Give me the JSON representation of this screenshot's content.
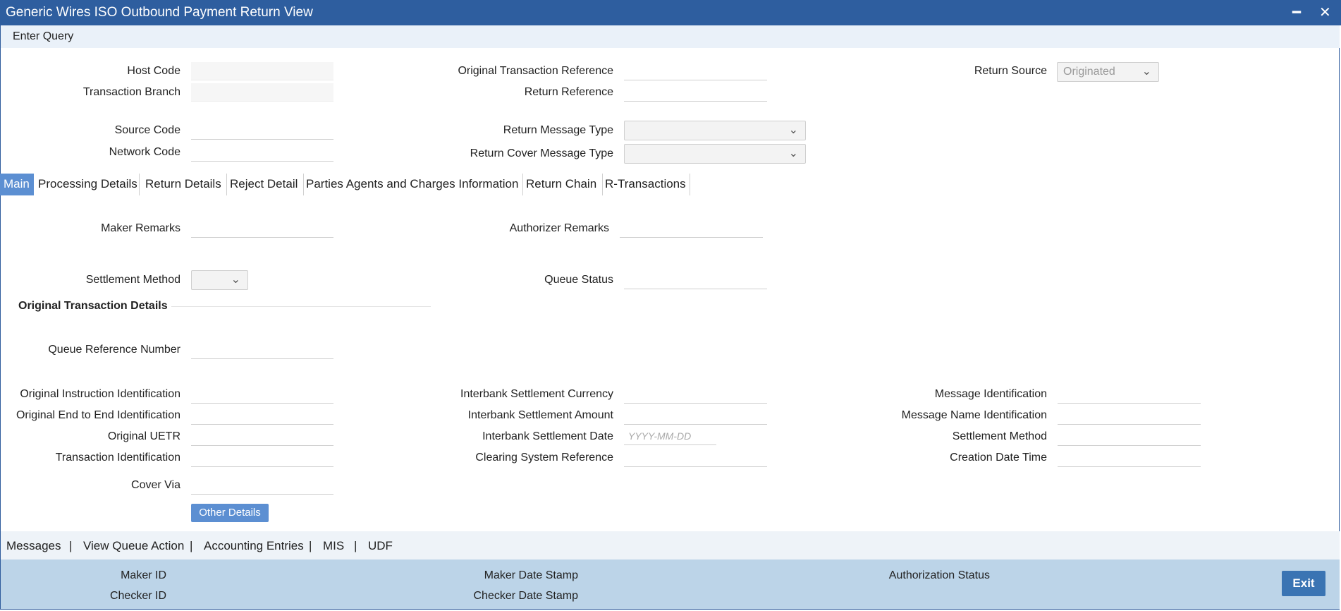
{
  "window": {
    "title": "Generic Wires ISO Outbound Payment Return View",
    "minimize": "━",
    "close": "✕"
  },
  "toolbar": {
    "enter_query": "Enter Query"
  },
  "header": {
    "host_code_label": "Host Code",
    "transaction_branch_label": "Transaction Branch",
    "source_code_label": "Source Code",
    "network_code_label": "Network Code",
    "original_transaction_reference_label": "Original Transaction Reference",
    "return_reference_label": "Return Reference",
    "return_message_type_label": "Return Message Type",
    "return_cover_message_type_label": "Return Cover Message Type",
    "return_source_label": "Return Source",
    "return_source_value": "Originated"
  },
  "tabs": [
    "Main",
    "Processing Details",
    "Return Details",
    "Reject Detail",
    "Parties Agents and Charges Information",
    "Return Chain",
    "R-Transactions"
  ],
  "main": {
    "maker_remarks_label": "Maker Remarks",
    "authorizer_remarks_label": "Authorizer Remarks",
    "settlement_method_label": "Settlement Method",
    "queue_status_label": "Queue Status",
    "section_title": "Original Transaction Details",
    "queue_reference_number_label": "Queue Reference Number",
    "original_instruction_identification_label": "Original Instruction Identification",
    "original_end_to_end_identification_label": "Original End to End Identification",
    "original_uetr_label": "Original UETR",
    "transaction_identification_label": "Transaction Identification",
    "cover_via_label": "Cover Via",
    "interbank_settlement_currency_label": "Interbank Settlement Currency",
    "interbank_settlement_amount_label": "Interbank Settlement Amount",
    "interbank_settlement_date_label": "Interbank Settlement Date",
    "interbank_settlement_date_placeholder": "YYYY-MM-DD",
    "clearing_system_reference_label": "Clearing System Reference",
    "message_identification_label": "Message Identification",
    "message_name_identification_label": "Message Name Identification",
    "settlement_method2_label": "Settlement Method",
    "creation_date_time_label": "Creation Date Time",
    "other_details_button": "Other Details"
  },
  "links": {
    "messages": "Messages",
    "sep": "|",
    "view_queue_action": "View Queue Action",
    "accounting_entries": "Accounting Entries",
    "mis": "MIS",
    "udf": "UDF"
  },
  "footer": {
    "maker_id_label": "Maker ID",
    "checker_id_label": "Checker ID",
    "maker_date_stamp_label": "Maker Date Stamp",
    "checker_date_stamp_label": "Checker Date Stamp",
    "authorization_status_label": "Authorization Status",
    "exit_button": "Exit"
  }
}
